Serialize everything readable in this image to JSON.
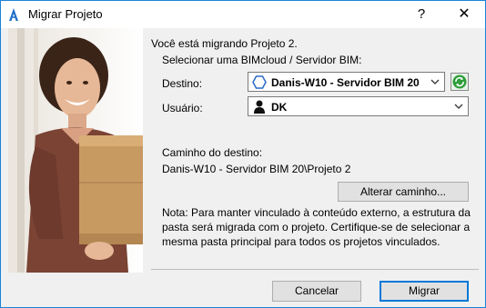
{
  "window": {
    "title": "Migrar Projeto",
    "help_glyph": "?",
    "close_glyph": "✕",
    "app_icon": "archicad-icon"
  },
  "intro_text": "Você está migrando Projeto 2.",
  "select_label": "Selecionar uma BIMcloud / Servidor BIM:",
  "destination": {
    "label": "Destino:",
    "value": "Danis-W10 - Servidor BIM 20",
    "icon": "server-hexagon-icon"
  },
  "refresh_icon": "refresh-icon",
  "user": {
    "label": "Usuário:",
    "value": "DK",
    "icon": "user-icon"
  },
  "path": {
    "label": "Caminho do destino:",
    "value": "Danis-W10 - Servidor BIM 20\\Projeto 2",
    "change_button": "Alterar caminho..."
  },
  "note": "Nota: Para manter vinculado à conteúdo externo, a estrutura da pasta será migrada com o projeto. Certifique-se de selecionar a mesma pasta principal para todos os projetos vinculados.",
  "buttons": {
    "cancel": "Cancelar",
    "ok": "Migrar"
  },
  "colors": {
    "accent": "#0078d7",
    "dialog_bg": "#f0f0f0",
    "refresh_green": "#2e9e3a"
  }
}
